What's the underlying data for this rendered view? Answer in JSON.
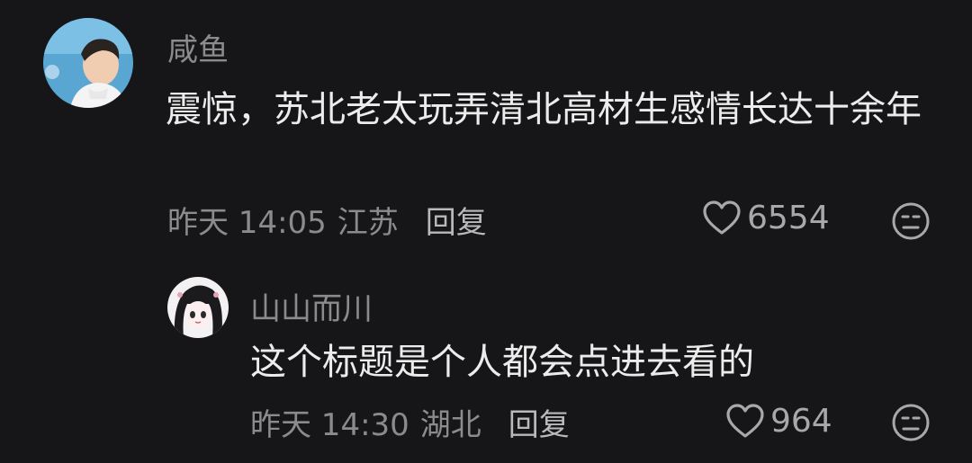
{
  "comments": [
    {
      "username": "咸鱼",
      "text": "震惊，苏北老太玩弄清北高材生感情长达十余年",
      "time": "昨天 14:05",
      "location": "江苏",
      "reply_label": "回复",
      "likes": "6554",
      "avatar_icon": "user-avatar-boy-icon",
      "like_icon": "heart-outline-icon",
      "dislike_icon": "meh-face-icon"
    },
    {
      "username": "山山而川",
      "text": "这个标题是个人都会点进去看的",
      "time": "昨天 14:30",
      "location": "湖北",
      "reply_label": "回复",
      "likes": "964",
      "avatar_icon": "user-avatar-anime-girl-icon",
      "like_icon": "heart-outline-icon",
      "dislike_icon": "meh-face-icon"
    }
  ],
  "colors": {
    "background": "#161618",
    "text_primary": "#ececec",
    "text_secondary": "#8b8b8d"
  }
}
